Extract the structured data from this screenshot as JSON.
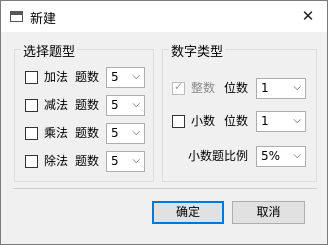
{
  "dialog": {
    "title": "新建",
    "icons": {
      "app": "window-icon",
      "close": "close-icon"
    },
    "accent_color": "#0078d7"
  },
  "question_types": {
    "title": "选择题型",
    "count_label": "题数",
    "rows": [
      {
        "name": "加法",
        "checked": false,
        "count": "5"
      },
      {
        "name": "减法",
        "checked": false,
        "count": "5"
      },
      {
        "name": "乘法",
        "checked": false,
        "count": "5"
      },
      {
        "name": "除法",
        "checked": false,
        "count": "5"
      }
    ]
  },
  "number_types": {
    "title": "数字类型",
    "integer": {
      "label": "整数",
      "checked": true,
      "disabled": true,
      "digits_label": "位数",
      "digits": "1"
    },
    "decimal": {
      "label": "小数",
      "checked": false,
      "digits_label": "位数",
      "digits": "1"
    },
    "ratio": {
      "label": "小数题比例",
      "value": "5%"
    }
  },
  "buttons": {
    "ok": "确定",
    "cancel": "取消"
  }
}
